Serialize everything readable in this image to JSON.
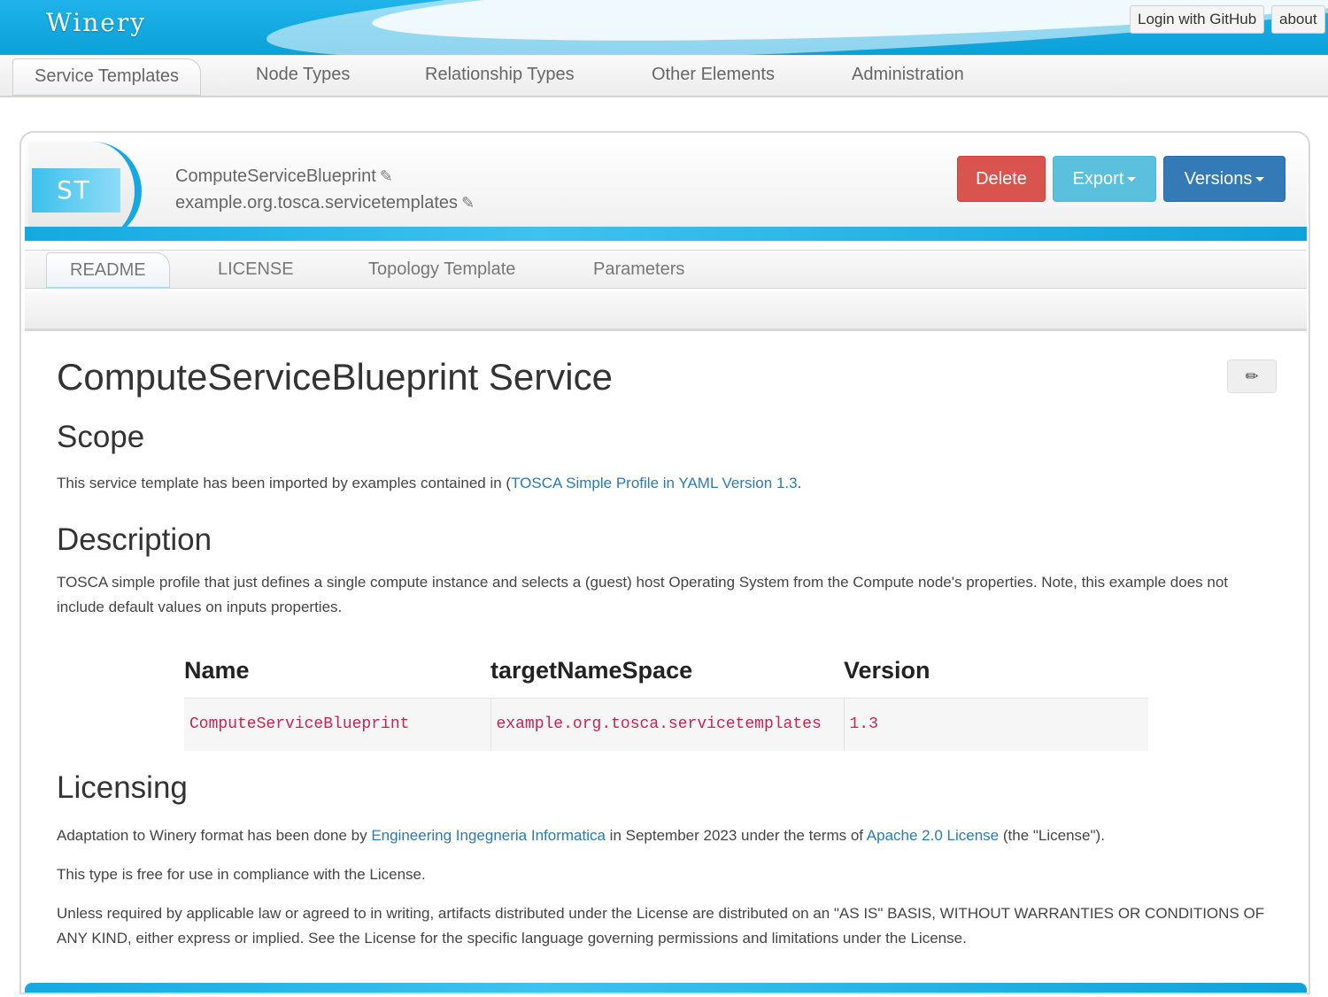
{
  "app": {
    "logo": "Winery"
  },
  "topbar": {
    "login_label": "Login with GitHub",
    "about_label": "about"
  },
  "mainnav": {
    "items": [
      {
        "label": "Service Templates",
        "active": true
      },
      {
        "label": "Node Types"
      },
      {
        "label": "Relationship Types"
      },
      {
        "label": "Other Elements"
      },
      {
        "label": "Administration"
      }
    ]
  },
  "entity": {
    "badge": "ST",
    "name": "ComputeServiceBlueprint",
    "namespace": "example.org.tosca.servicetemplates",
    "edit_icon": "edit-icon",
    "buttons": {
      "delete": "Delete",
      "export": "Export",
      "versions": "Versions"
    }
  },
  "subnav": {
    "items": [
      {
        "label": "README",
        "active": true
      },
      {
        "label": "LICENSE"
      },
      {
        "label": "Topology Template"
      },
      {
        "label": "Parameters"
      }
    ]
  },
  "readme": {
    "title": "ComputeServiceBlueprint Service",
    "scope_heading": "Scope",
    "scope_text": "This service template has been imported by examples contained in (",
    "scope_link": "TOSCA Simple Profile in YAML Version 1.3",
    "scope_end": ".",
    "description_heading": "Description",
    "description_text": "TOSCA simple profile that just defines a single compute instance and selects a (guest) host Operating System from the Compute node's properties. Note, this example does not include default values on inputs properties.",
    "table": {
      "headers": [
        "Name",
        "targetNameSpace",
        "Version"
      ],
      "row": [
        "ComputeServiceBlueprint",
        "example.org.tosca.servicetemplates",
        "1.3"
      ]
    },
    "licensing_heading": "Licensing",
    "lic_p1_a": "Adaptation to Winery format has been done by ",
    "lic_p1_link1": "Engineering Ingegneria Informatica",
    "lic_p1_b": " in September 2023 under the terms of ",
    "lic_p1_link2": "Apache 2.0 License",
    "lic_p1_c": " (the \"License\").",
    "lic_p2": "This type is free for use in compliance with the License.",
    "lic_p3": "Unless required by applicable law or agreed to in writing, artifacts distributed under the License are distributed on an \"AS IS\" BASIS, WITHOUT WARRANTIES OR CONDITIONS OF ANY KIND, either express or implied. See the License for the specific language governing permissions and limitations under the License."
  },
  "colors": {
    "accent": "#15a8e3",
    "danger": "#d9534f",
    "info": "#5bc0de",
    "primary": "#337ab7",
    "code": "#c7254e"
  }
}
